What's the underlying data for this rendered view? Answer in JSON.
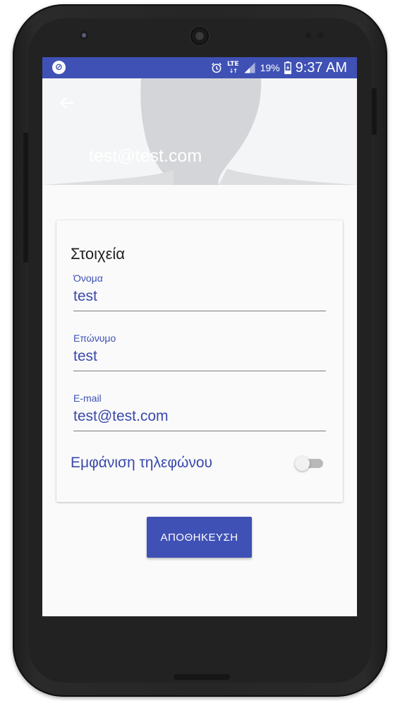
{
  "status_bar": {
    "battery_percent": "19%",
    "network": "LTE",
    "time": "9:37 AM",
    "color": "#3f51b5"
  },
  "header": {
    "email": "test@test.com",
    "back_icon": "arrow-left-icon"
  },
  "card": {
    "title": "Στοιχεία",
    "fields": [
      {
        "label": "Όνομα",
        "value": "test"
      },
      {
        "label": "Επώνυμο",
        "value": "test"
      },
      {
        "label": "E-mail",
        "value": "test@test.com"
      }
    ],
    "toggle": {
      "label": "Εμφάνιση τηλεφώνου",
      "on": false
    }
  },
  "save_button": {
    "label": "ΑΠΟΘΗΚΕΥΣΗ"
  },
  "colors": {
    "primary": "#3f51b5",
    "text_accent": "#3949ab"
  }
}
